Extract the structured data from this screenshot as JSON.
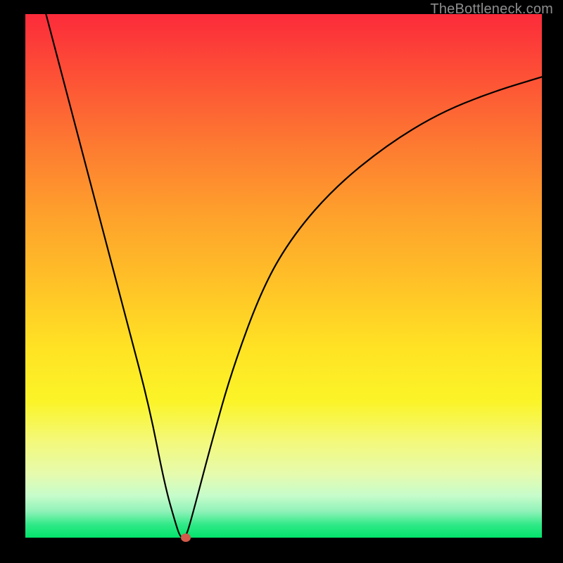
{
  "watermark": "TheBottleneck.com",
  "colors": {
    "frame": "#000000",
    "curve": "#000000",
    "dot": "#d15a4a",
    "gradient_top": "#fc2b3a",
    "gradient_bottom": "#02e36b"
  },
  "chart_data": {
    "type": "line",
    "title": "",
    "xlabel": "",
    "ylabel": "",
    "xlim": [
      0,
      100
    ],
    "ylim": [
      0,
      100
    ],
    "x": [
      4,
      8,
      12,
      16,
      20,
      24,
      27,
      29,
      30,
      31,
      32,
      36,
      40,
      46,
      52,
      60,
      70,
      80,
      90,
      100
    ],
    "values": [
      100,
      85,
      70,
      55,
      40,
      25,
      10,
      3,
      0,
      0,
      3,
      18,
      32,
      48,
      58,
      67,
      75,
      81,
      85,
      88
    ],
    "minimum_marker": {
      "x": 31,
      "y": 0
    },
    "annotations": [],
    "grid": false,
    "legend": false
  }
}
